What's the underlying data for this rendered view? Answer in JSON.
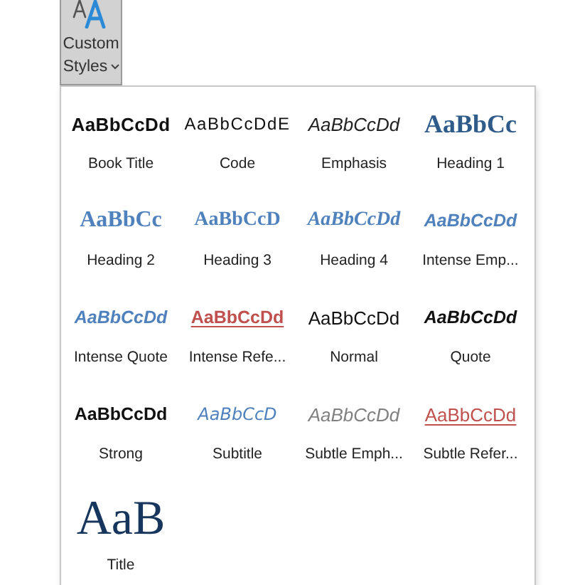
{
  "button": {
    "label_line_1": "Custom",
    "label_line_2": "Styles",
    "expanded": true
  },
  "styles": [
    {
      "kind": "booktitle",
      "preview": "AaBbCcDd",
      "name": "Book Title"
    },
    {
      "kind": "code",
      "preview": "AaBbCcDdE",
      "name": "Code"
    },
    {
      "kind": "emphasis",
      "preview": "AaBbCcDd",
      "name": "Emphasis"
    },
    {
      "kind": "heading1",
      "preview": "AaBbCc",
      "name": "Heading 1"
    },
    {
      "kind": "heading2",
      "preview": "AaBbCc",
      "name": "Heading 2"
    },
    {
      "kind": "heading3",
      "preview": "AaBbCcD",
      "name": "Heading 3"
    },
    {
      "kind": "heading4",
      "preview": "AaBbCcDd",
      "name": "Heading 4"
    },
    {
      "kind": "intenseemphasis",
      "preview": "AaBbCcDd",
      "name": "Intense Emp..."
    },
    {
      "kind": "intensequote",
      "preview": "AaBbCcDd",
      "name": "Intense Quote"
    },
    {
      "kind": "intensereference",
      "preview": "AaBbCcDd",
      "name": "Intense Refe..."
    },
    {
      "kind": "normal",
      "preview": "AaBbCcDd",
      "name": "Normal"
    },
    {
      "kind": "quote",
      "preview": "AaBbCcDd",
      "name": "Quote"
    },
    {
      "kind": "strong",
      "preview": "AaBbCcDd",
      "name": "Strong"
    },
    {
      "kind": "subtitle",
      "preview": "AaBbCcD",
      "name": "Subtitle"
    },
    {
      "kind": "subtleemphasis",
      "preview": "AaBbCcDd",
      "name": "Subtle Emph..."
    },
    {
      "kind": "subtlereference",
      "preview": "AaBbCcDd",
      "name": "Subtle Refer..."
    },
    {
      "kind": "title",
      "preview": "AaB",
      "name": "Title"
    }
  ]
}
